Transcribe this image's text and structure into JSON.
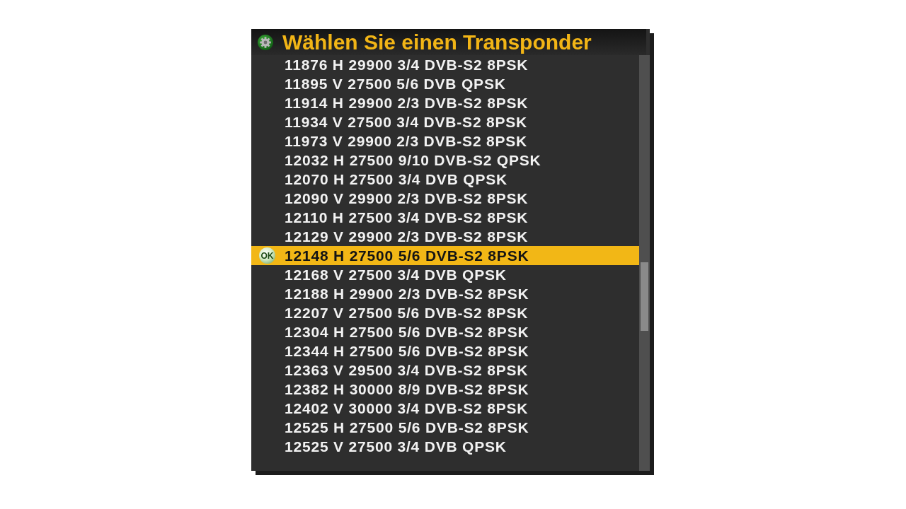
{
  "dialog": {
    "title": "Wählen Sie einen Transponder",
    "selected_marker": "OK",
    "transponders": [
      {
        "label": "11876 H 29900 3/4 DVB-S2 8PSK",
        "selected": false
      },
      {
        "label": "11895 V 27500 5/6 DVB QPSK",
        "selected": false
      },
      {
        "label": "11914 H 29900 2/3 DVB-S2 8PSK",
        "selected": false
      },
      {
        "label": "11934 V 27500 3/4 DVB-S2 8PSK",
        "selected": false
      },
      {
        "label": "11973 V 29900 2/3 DVB-S2 8PSK",
        "selected": false
      },
      {
        "label": "12032 H 27500 9/10 DVB-S2 QPSK",
        "selected": false
      },
      {
        "label": "12070 H 27500 3/4 DVB QPSK",
        "selected": false
      },
      {
        "label": "12090 V 29900 2/3 DVB-S2 8PSK",
        "selected": false
      },
      {
        "label": "12110 H 27500 3/4 DVB-S2 8PSK",
        "selected": false
      },
      {
        "label": "12129 V 29900 2/3 DVB-S2 8PSK",
        "selected": false
      },
      {
        "label": "12148 H 27500 5/6 DVB-S2 8PSK",
        "selected": true
      },
      {
        "label": "12168 V 27500 3/4 DVB QPSK",
        "selected": false
      },
      {
        "label": "12188 H 29900 2/3 DVB-S2 8PSK",
        "selected": false
      },
      {
        "label": "12207 V 27500 5/6 DVB-S2 8PSK",
        "selected": false
      },
      {
        "label": "12304 H 27500 5/6 DVB-S2 8PSK",
        "selected": false
      },
      {
        "label": "12344 H 27500 5/6 DVB-S2 8PSK",
        "selected": false
      },
      {
        "label": "12363 V 29500 3/4 DVB-S2 8PSK",
        "selected": false
      },
      {
        "label": "12382 H 30000 8/9 DVB-S2 8PSK",
        "selected": false
      },
      {
        "label": "12402 V 30000 3/4 DVB-S2 8PSK",
        "selected": false
      },
      {
        "label": "12525 H 27500 5/6 DVB-S2 8PSK",
        "selected": false
      },
      {
        "label": "12525 V 27500 3/4 DVB QPSK",
        "selected": false
      }
    ]
  }
}
